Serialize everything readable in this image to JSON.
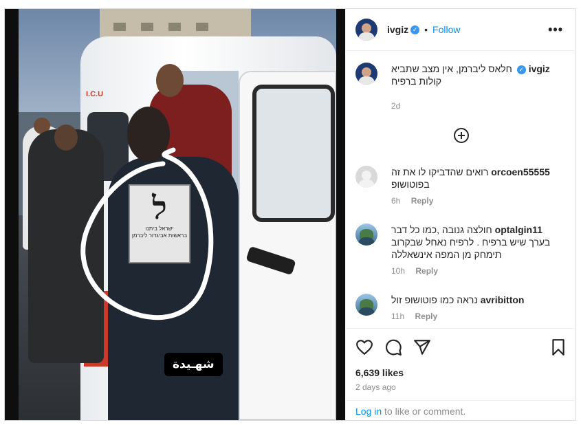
{
  "post": {
    "author": "ivgiz",
    "follow_label": "Follow",
    "dot": "•",
    "verified_mark": "✓",
    "more_label": "•••",
    "caption_text": "חלאס ליברמן, אין מצב שתביא קולות ברפיח",
    "caption_time": "2d",
    "video_caption": "شهـيدة",
    "shirt_letter": "ל",
    "shirt_line1": "ישראל ביתנו",
    "shirt_line2": "בראשות אביגדור ליברמן",
    "ambulance_text": "I.C.U"
  },
  "comments": [
    {
      "user": "orcoen55555",
      "text": "רואים שהדביקו לו את זה בפוטושופ",
      "time": "6h",
      "reply": "Reply"
    },
    {
      "user": "optalgin11",
      "text": "חולצה גנובה ,כמו כל דבר בערך שיש ברפיח . לרפיח נאחל שבקרוב תימחק מן המפה אינשאללה",
      "time": "10h",
      "reply": "Reply"
    },
    {
      "user": "avribitton",
      "text": "נראה כמו פוטושופ זול",
      "time": "11h",
      "reply": "Reply"
    }
  ],
  "footer": {
    "likes": "6,639 likes",
    "date": "2 days ago",
    "login_link": "Log in",
    "login_rest": " to like or comment."
  },
  "icons": {
    "load_more": "plus-circle-icon",
    "like": "heart-icon",
    "comment": "speech-bubble-icon",
    "share": "paper-plane-icon",
    "save": "bookmark-icon"
  },
  "colors": {
    "link": "#0095f6",
    "verified": "#3897f0",
    "muted": "#8e8e8e",
    "text": "#262626"
  }
}
